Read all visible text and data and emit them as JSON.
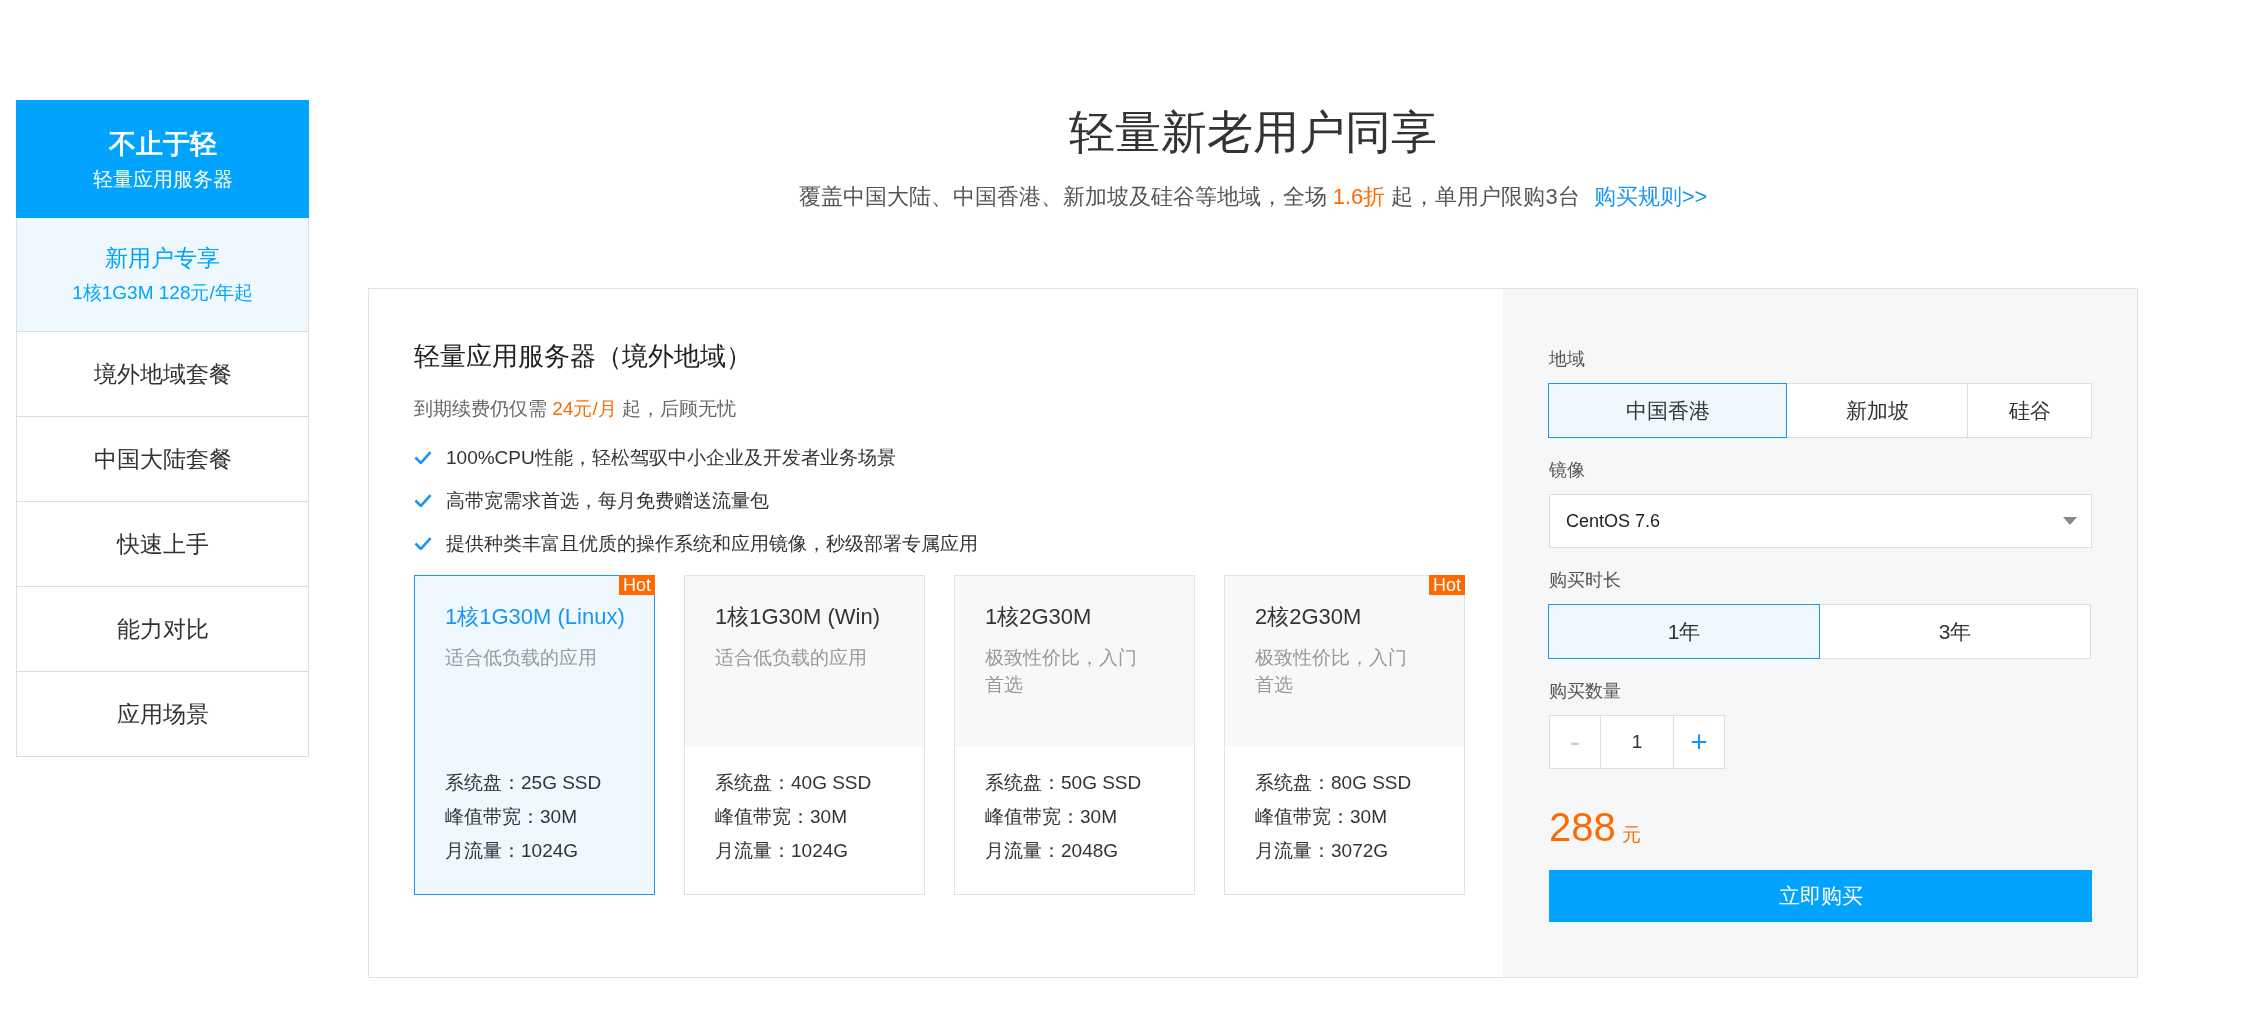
{
  "sidebar": {
    "banner": {
      "title": "不止于轻",
      "subtitle": "轻量应用服务器"
    },
    "items": [
      {
        "label": "新用户专享",
        "sublabel": "1核1G3M 128元/年起",
        "selected": true
      },
      {
        "label": "境外地域套餐",
        "selected": false
      },
      {
        "label": "中国大陆套餐",
        "selected": false
      },
      {
        "label": "快速上手",
        "selected": false
      },
      {
        "label": "能力对比",
        "selected": false
      },
      {
        "label": "应用场景",
        "selected": false
      }
    ]
  },
  "header": {
    "title": "轻量新老用户同享",
    "subtitle_before": "覆盖中国大陆、中国香港、新加坡及硅谷等地域，全场 ",
    "subtitle_highlight": "1.6折",
    "subtitle_after": " 起，单用户限购3台",
    "rules_link": "购买规则>>"
  },
  "product": {
    "title": "轻量应用服务器（境外地域）",
    "renewal_before": "到期续费仍仅需 ",
    "renewal_highlight": "24元/月",
    "renewal_after": " 起，后顾无忧",
    "features": [
      "100%CPU性能，轻松驾驭中小企业及开发者业务场景",
      "高带宽需求首选，每月免费赠送流量包",
      "提供种类丰富且优质的操作系统和应用镜像，秒级部署专属应用"
    ],
    "plans": [
      {
        "name": "1核1G30M (Linux)",
        "desc": "适合低负载的应用",
        "specs": [
          "系统盘：25G SSD",
          "峰值带宽：30M",
          "月流量：1024G"
        ],
        "selected": true,
        "badge": "Hot"
      },
      {
        "name": "1核1G30M (Win)",
        "desc": "适合低负载的应用",
        "specs": [
          "系统盘：40G SSD",
          "峰值带宽：30M",
          "月流量：1024G"
        ],
        "selected": false
      },
      {
        "name": "1核2G30M",
        "desc": "极致性价比，入门首选",
        "specs": [
          "系统盘：50G SSD",
          "峰值带宽：30M",
          "月流量：2048G"
        ],
        "selected": false
      },
      {
        "name": "2核2G30M",
        "desc": "极致性价比，入门首选",
        "specs": [
          "系统盘：80G SSD",
          "峰值带宽：30M",
          "月流量：3072G"
        ],
        "selected": false,
        "badge": "Hot"
      }
    ]
  },
  "order": {
    "region_label": "地域",
    "regions": [
      {
        "label": "中国香港",
        "selected": true
      },
      {
        "label": "新加坡",
        "selected": false
      },
      {
        "label": "硅谷",
        "selected": false
      }
    ],
    "image_label": "镜像",
    "image_value": "CentOS 7.6",
    "duration_label": "购买时长",
    "durations": [
      {
        "label": "1年",
        "selected": true
      },
      {
        "label": "3年",
        "selected": false
      }
    ],
    "quantity_label": "购买数量",
    "minus": "-",
    "minus_disabled": true,
    "quantity": "1",
    "plus": "+",
    "price": "288",
    "currency": "元",
    "buy_button": "立即购买"
  }
}
